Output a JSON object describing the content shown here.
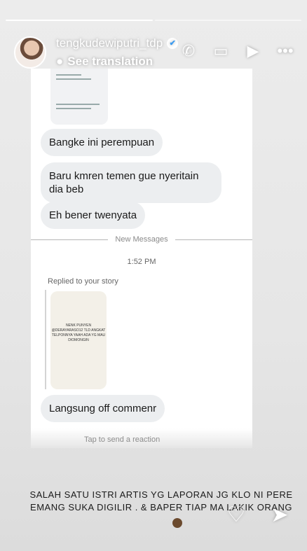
{
  "header": {
    "username": "tengkudewiputri_tdp",
    "see_translation": "See translation"
  },
  "icons": {
    "verified": "✔",
    "translate": "●",
    "phone": "✆",
    "video": "▭",
    "send_top": "▶",
    "more": "•••",
    "heart": "♡",
    "share": "➤"
  },
  "chat": {
    "messages": [
      "Bangke ini perempuan",
      "Baru kmren temen gue nyeritain dia beb",
      "Eh bener twenyata"
    ],
    "new_messages": "New Messages",
    "time": "1:52 PM",
    "replied": "Replied to your story",
    "story_text": "NENK PUNYEN @DERAYARASO12 TLD ANGKAT TELPONNYA YAAH ADA YG MAU DIOMONGIN",
    "last_message": "Langsung off commenr",
    "reaction_hint": "Tap to send a reaction"
  },
  "caption": {
    "text": "SALAH SATU ISTRI ARTIS YG LAPORAN JG KLO NI PERE EMANG SUKA DIGILIR . & BAPER TIAP MA LAKIK ORANG"
  }
}
